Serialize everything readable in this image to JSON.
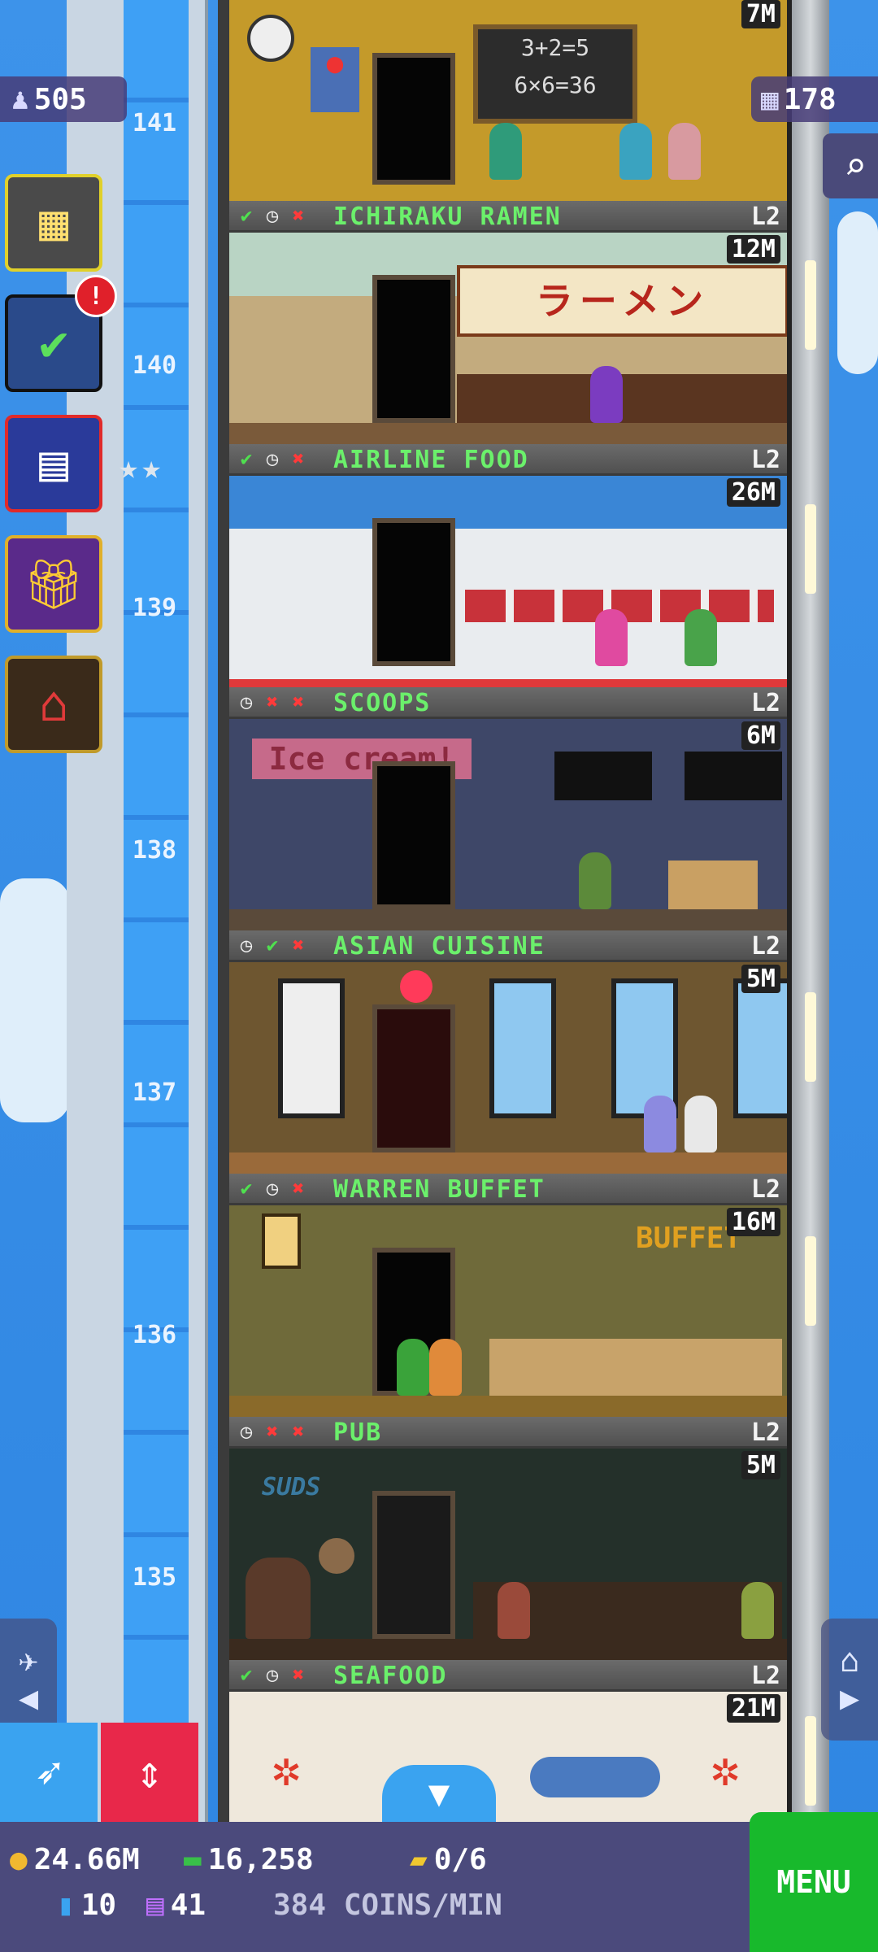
{
  "top": {
    "population": "505",
    "floors_count": "178",
    "top_floor_price": "7M"
  },
  "shaft_floor_numbers": [
    "141",
    "140",
    "139",
    "138",
    "137",
    "136",
    "135"
  ],
  "floors": [
    {
      "name": "ICHIRAKU RAMEN",
      "level": "L2",
      "price": "12M",
      "status": [
        "ok",
        "clk",
        "x"
      ]
    },
    {
      "name": "AIRLINE FOOD",
      "level": "L2",
      "price": "26M",
      "status": [
        "ok",
        "clk",
        "x"
      ]
    },
    {
      "name": "SCOOPS",
      "level": "L2",
      "price": "6M",
      "status": [
        "clk",
        "x",
        "x"
      ]
    },
    {
      "name": "ASIAN CUISINE",
      "level": "L2",
      "price": "5M",
      "status": [
        "clk",
        "ok",
        "x"
      ]
    },
    {
      "name": "WARREN BUFFET",
      "level": "L2",
      "price": "16M",
      "status": [
        "ok",
        "clk",
        "x"
      ]
    },
    {
      "name": "PUB",
      "level": "L2",
      "price": "5M",
      "status": [
        "clk",
        "x",
        "x"
      ]
    },
    {
      "name": "SEAFOOD",
      "level": "L2",
      "price": "21M",
      "status": [
        "ok",
        "clk",
        "x"
      ]
    }
  ],
  "scene_text": {
    "chalkboard_line1": "3+2=5",
    "chalkboard_line2": "6×6=36",
    "ramen_sign": "ラーメン",
    "ice_cream_sign": "Ice cream!",
    "buffet_sign": "BUFFET",
    "suds_sign": "SUDS"
  },
  "side_badge": "!",
  "bottom_bar": {
    "coins": "24.66M",
    "bux": "16,258",
    "tickets": "0/6",
    "elevator_count": "10",
    "vip": "41",
    "rate": "384 COINS/MIN",
    "menu_label": "MENU"
  },
  "colors": {
    "sky": "#3a8fe8",
    "floor_name_green": "#6bf06b",
    "menu_green": "#18b92c",
    "bottom_bar": "#4b4a7c"
  }
}
